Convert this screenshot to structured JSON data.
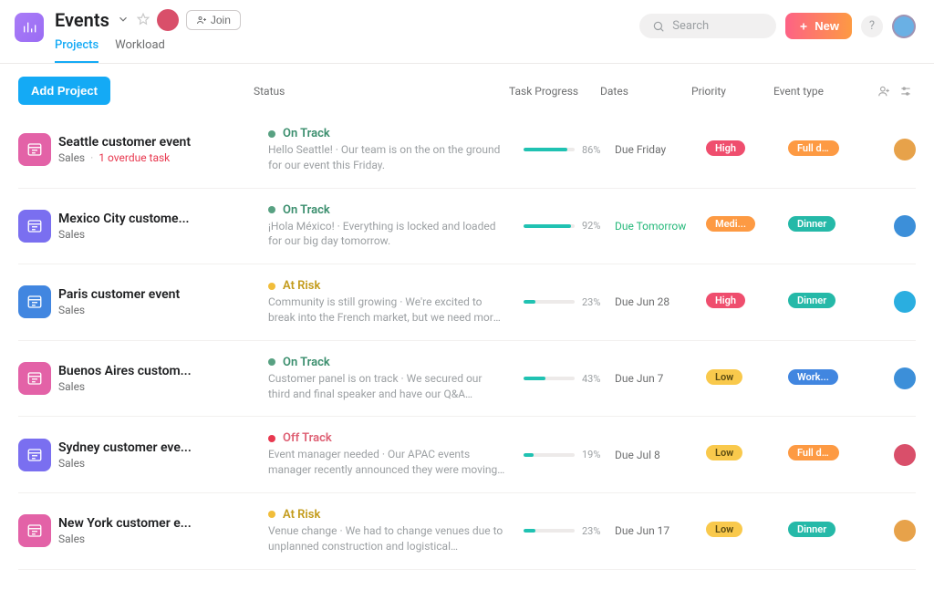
{
  "header": {
    "title": "Events",
    "join_label": "Join",
    "tabs": {
      "projects": "Projects",
      "workload": "Workload"
    },
    "search_placeholder": "Search",
    "new_label": "New",
    "help_label": "?",
    "member_avatar_color": "#d94f6a",
    "me_avatar_color": "#6ab0e4"
  },
  "toolbar": {
    "add_project": "Add Project",
    "columns": {
      "status": "Status",
      "task_progress": "Task Progress",
      "dates": "Dates",
      "priority": "Priority",
      "event_type": "Event type"
    }
  },
  "priority_colors": {
    "High": "pill-red",
    "Medium": "pill-orange",
    "Low": "pill-yellow"
  },
  "event_type_colors": {
    "Full day": "pill-orange",
    "Dinner": "pill-teal",
    "Workshop": "pill-blue"
  },
  "status_styles": {
    "On Track": {
      "dot": "dot-green",
      "text": "txt-green"
    },
    "At Risk": {
      "dot": "dot-yellow",
      "text": "txt-yellow"
    },
    "Off Track": {
      "dot": "dot-red",
      "text": "txt-red"
    }
  },
  "projects": [
    {
      "name": "Seattle customer event",
      "team": "Sales",
      "overdue": "1 overdue task",
      "icon_color": "#e362a7",
      "status": "On Track",
      "status_note": "Hello Seattle! · Our team is on the on the ground for our event this Friday.",
      "progress": 86,
      "date": "Due Friday",
      "date_soon": false,
      "priority": "High",
      "priority_display": "High",
      "event_type": "Full day",
      "event_type_display": "Full d...",
      "owner_color": "#e7a24a"
    },
    {
      "name": "Mexico City custome...",
      "team": "Sales",
      "overdue": "",
      "icon_color": "#7a6ff0",
      "status": "On Track",
      "status_note": "¡Hola México! · Everything is locked and loaded for our big day tomorrow.",
      "progress": 92,
      "date": "Due Tomorrow",
      "date_soon": true,
      "priority": "Medium",
      "priority_display": "Medi...",
      "event_type": "Dinner",
      "event_type_display": "Dinner",
      "owner_color": "#3c8fd9"
    },
    {
      "name": "Paris customer event",
      "team": "Sales",
      "overdue": "",
      "icon_color": "#4186e0",
      "status": "At Risk",
      "status_note": "Community is still growing · We're excited to break into the French market, but we need more customer...",
      "progress": 23,
      "date": "Due Jun 28",
      "date_soon": false,
      "priority": "High",
      "priority_display": "High",
      "event_type": "Dinner",
      "event_type_display": "Dinner",
      "owner_color": "#2aaee0"
    },
    {
      "name": "Buenos Aires custom...",
      "team": "Sales",
      "overdue": "",
      "icon_color": "#e362a7",
      "status": "On Track",
      "status_note": "Customer panel is on track · We secured our third and final speaker and have our Q&A scheduled for Friday...",
      "progress": 43,
      "date": "Due Jun 7",
      "date_soon": false,
      "priority": "Low",
      "priority_display": "Low",
      "event_type": "Workshop",
      "event_type_display": "Work...",
      "owner_color": "#3c8fd9"
    },
    {
      "name": "Sydney customer eve...",
      "team": "Sales",
      "overdue": "",
      "icon_color": "#7a6ff0",
      "status": "Off Track",
      "status_note": "Event manager needed · Our APAC events manager recently announced they were moving to London, so...",
      "progress": 19,
      "date": "Due Jul 8",
      "date_soon": false,
      "priority": "Low",
      "priority_display": "Low",
      "event_type": "Full day",
      "event_type_display": "Full d...",
      "owner_color": "#d94f6a"
    },
    {
      "name": "New York customer e...",
      "team": "Sales",
      "overdue": "",
      "icon_color": "#e362a7",
      "status": "At Risk",
      "status_note": "Venue change · We had to change venues due to unplanned construction and logistical constraints.",
      "progress": 23,
      "date": "Due Jun 17",
      "date_soon": false,
      "priority": "Low",
      "priority_display": "Low",
      "event_type": "Dinner",
      "event_type_display": "Dinner",
      "owner_color": "#e7a24a"
    }
  ]
}
